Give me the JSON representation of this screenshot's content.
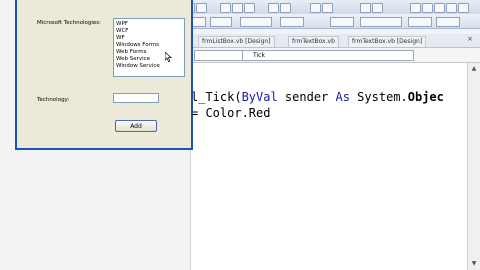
{
  "form": {
    "technologies_label": "Microsoft Technologies:",
    "technologies": [
      "WPF",
      "WCF",
      "WF",
      "Windows Forms",
      "Web Forms",
      "Web Service",
      "Window Service"
    ],
    "technology_label": "Technology:",
    "technology_value": "",
    "add_button": "Add"
  },
  "tabs": [
    {
      "label": "frmListBox.vb [Design]"
    },
    {
      "label": "frmTextBox.vb"
    },
    {
      "label": "frmTextBox.vb [Design]"
    }
  ],
  "tab_close": "×",
  "method_dropdown": "Tick",
  "code": {
    "line1_prefix": "l_Tick(",
    "line1_kw1": "ByVal",
    "line1_mid": " sender ",
    "line1_kw2": "As",
    "line1_rest": " System.",
    "line1_end": "Objec",
    "line2": "= Color.Red"
  }
}
